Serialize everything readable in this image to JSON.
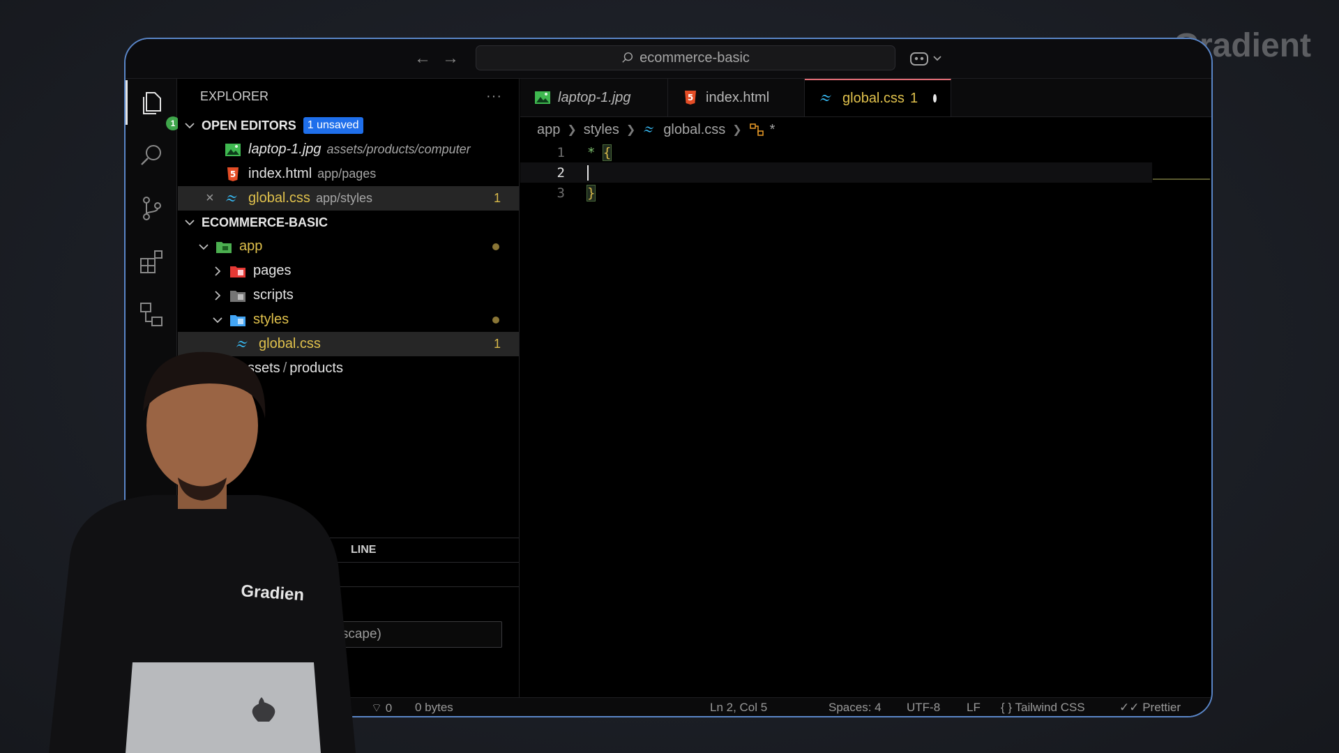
{
  "watermark": "Gradient",
  "titlebar": {
    "search_text": "ecommerce-basic"
  },
  "activity": {
    "explorer_badge": "1"
  },
  "sidebar": {
    "title": "EXPLORER",
    "more": "···",
    "open_editors": {
      "label": "OPEN EDITORS",
      "badge": "1 unsaved",
      "items": [
        {
          "name": "laptop-1.jpg",
          "path": "assets/products/computer"
        },
        {
          "name": "index.html",
          "path": "app/pages"
        },
        {
          "name": "global.css",
          "path": "app/styles",
          "count": "1"
        }
      ]
    },
    "project": {
      "label": "ECOMMERCE-BASIC",
      "items": [
        {
          "name": "app"
        },
        {
          "name": "pages"
        },
        {
          "name": "scripts"
        },
        {
          "name": "styles"
        },
        {
          "name": "global.css",
          "count": "1"
        },
        {
          "name": "ssets",
          "sep": "/",
          "name2": "products"
        }
      ]
    },
    "outline_label": "LINE",
    "search_placeholder": "clude, \\escape)"
  },
  "tabs": [
    {
      "label": "laptop-1.jpg"
    },
    {
      "label": "index.html"
    },
    {
      "label": "global.css",
      "count": "1"
    }
  ],
  "breadcrumb": {
    "parts": [
      "app",
      "styles",
      "global.css"
    ],
    "symbol": "*"
  },
  "code": {
    "lines": [
      {
        "num": "1",
        "selector": "*",
        "brace": "{"
      },
      {
        "num": "2"
      },
      {
        "num": "3",
        "brace": "}"
      }
    ]
  },
  "status": {
    "ports": "0",
    "size": "0 bytes",
    "position": "Ln 2, Col 5",
    "spaces": "Spaces: 4",
    "encoding": "UTF-8",
    "eol": "LF",
    "language": "Tailwind CSS",
    "formatter": "Prettier"
  },
  "person": {
    "shirt_text": "Gradien"
  },
  "colors": {
    "accent_blue": "#1f6feb",
    "modified_yellow": "#e0c14c",
    "window_border": "#5a86c8",
    "badge_green": "#3fa64b"
  }
}
